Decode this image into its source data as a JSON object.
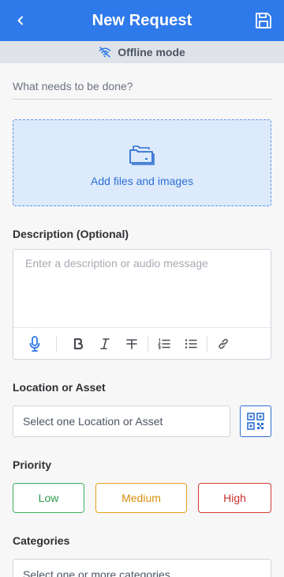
{
  "header": {
    "title": "New Request",
    "back_icon": "chevron-left-icon",
    "save_icon": "floppy-disk-icon"
  },
  "status_bar": {
    "label": "Offline mode",
    "icon": "wifi-off-icon"
  },
  "title_field": {
    "placeholder": "What needs to be done?",
    "value": ""
  },
  "attachments": {
    "label": "Add files and images",
    "icon": "folders-icon"
  },
  "description": {
    "label": "Description (Optional)",
    "placeholder": "Enter a description or audio message",
    "value": "",
    "toolbar": [
      "microphone-icon",
      "bold-icon",
      "italic-icon",
      "strikethrough-icon",
      "ordered-list-icon",
      "bullet-list-icon",
      "link-icon"
    ]
  },
  "location": {
    "label": "Location or Asset",
    "placeholder": "Select one Location or Asset",
    "qr_icon": "qr-code-icon"
  },
  "priority": {
    "label": "Priority",
    "options": [
      {
        "label": "Low",
        "color": "#3fae5c"
      },
      {
        "label": "Medium",
        "color": "#e8a019"
      },
      {
        "label": "High",
        "color": "#d33b32"
      }
    ]
  },
  "categories": {
    "label": "Categories",
    "placeholder": "Select one or more categories"
  },
  "colors": {
    "accent": "#2f7aeb",
    "status_bar_bg": "#dfe3e9",
    "dropzone_bg": "#dceafc"
  }
}
